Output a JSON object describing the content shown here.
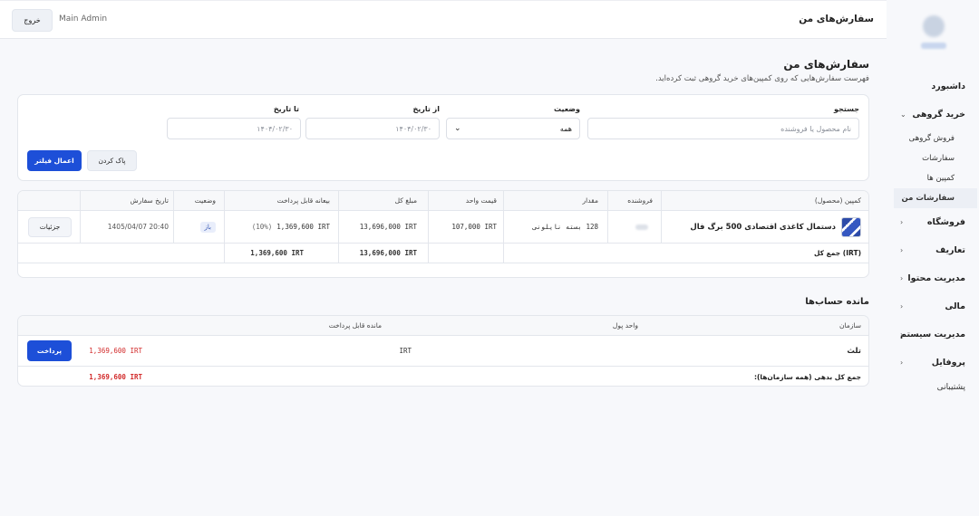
{
  "topbar": {
    "title": "سفارش‌های من",
    "user": "Main Admin",
    "logout_label": "خروج"
  },
  "sidebar": {
    "items": [
      {
        "label": "داشبورد"
      },
      {
        "label": "خرید گروهی",
        "expanded": true,
        "children": [
          {
            "label": "فروش گروهی"
          },
          {
            "label": "سفارشات"
          },
          {
            "label": "کمپین ها"
          },
          {
            "label": "سفارشات من",
            "active": true
          }
        ]
      },
      {
        "label": "فروشگاه"
      },
      {
        "label": "تعاریف"
      },
      {
        "label": "مدیریت محتوا"
      },
      {
        "label": "مالی"
      },
      {
        "label": "مدیریت سیستم"
      },
      {
        "label": "پروفایل"
      },
      {
        "label": "پشتیبانی"
      }
    ]
  },
  "page": {
    "title": "سفارش‌های من",
    "subtitle": "فهرست سفارش‌هایی که روی کمپین‌های خرید گروهی ثبت کرده‌اید."
  },
  "filters": {
    "search_label": "جستجو",
    "search_placeholder": "نام محصول یا فروشنده",
    "status_label": "وضعیت",
    "status_value": "همه",
    "from_label": "از تاریخ",
    "from_value": "۱۴۰۴/۰۲/۳۰",
    "to_label": "تا تاریخ",
    "to_value": "۱۴۰۴/۰۲/۳۰",
    "apply_label": "اعمال فیلتر",
    "clear_label": "پاک کردن"
  },
  "orders": {
    "headers": {
      "campaign": "کمپین (محصول)",
      "seller": "فروشنده",
      "qty": "مقدار",
      "unit_price": "قیمت واحد",
      "total": "مبلغ کل",
      "deposit": "بیعانه قابل پرداخت",
      "status": "وضعیت",
      "date": "تاریخ سفارش"
    },
    "rows": [
      {
        "product": "دستمال کاغذی اقتصادی 500 برگ فال",
        "qty": "128 بسته نایلونی",
        "unit_price": "107,000 IRT",
        "total": "13,696,000 IRT",
        "deposit": "1,369,600 IRT",
        "deposit_pct": "(10%)",
        "status": "باز",
        "date": "1405/04/07 20:40",
        "details_label": "جزئیات"
      }
    ],
    "footer": {
      "label": "جمع کل (IRT)",
      "total": "13,696,000 IRT",
      "deposit": "1,369,600 IRT"
    }
  },
  "balances": {
    "title": "مانده حساب‌ها",
    "headers": {
      "org": "سازمان",
      "currency": "واحد پول",
      "remaining": "مانده قابل پرداخت"
    },
    "rows": [
      {
        "org": "تلث",
        "currency": "IRT",
        "remaining": "1,369,600 IRT",
        "pay_label": "پرداخت"
      }
    ],
    "footer": {
      "label": "جمع کل بدهی (همه سازمان‌ها):",
      "value": "1,369,600 IRT"
    }
  },
  "colors": {
    "primary": "#1d4fd8",
    "debt": "#d22b2b"
  }
}
